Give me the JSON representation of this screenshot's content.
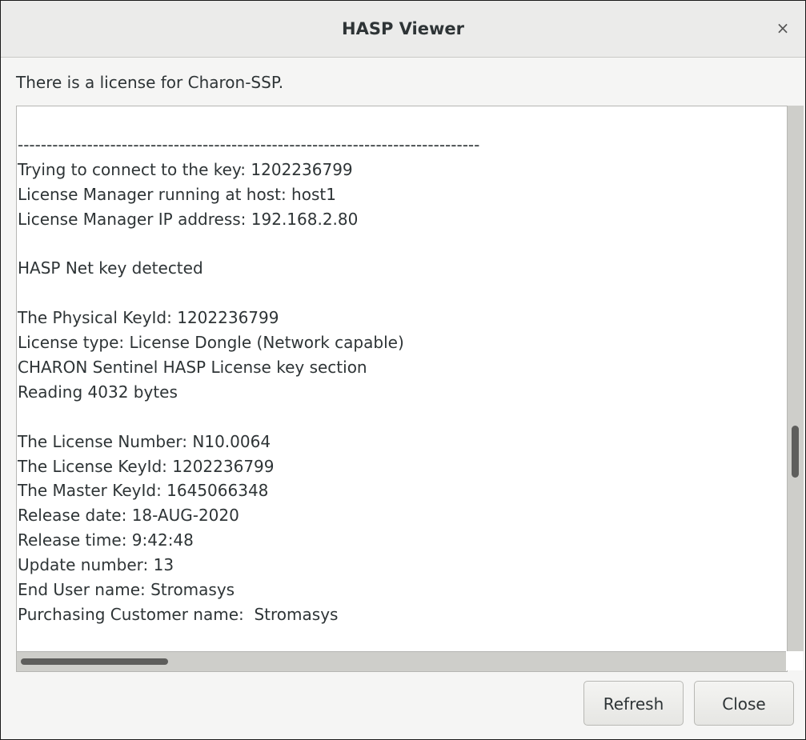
{
  "window": {
    "title": "HASP Viewer",
    "close_glyph": "×"
  },
  "status_text": "There is a license for Charon-SSP.",
  "log_lines": [
    "--------------------------------------------------------------------------------",
    "Trying to connect to the key: 1202236799",
    "License Manager running at host: host1",
    "License Manager IP address: 192.168.2.80",
    "",
    "HASP Net key detected",
    "",
    "The Physical KeyId: 1202236799",
    "License type: License Dongle (Network capable)",
    "CHARON Sentinel HASP License key section",
    "Reading 4032 bytes",
    "",
    "The License Number: N10.0064",
    "The License KeyId: 1202236799",
    "The Master KeyId: 1645066348",
    "Release date: 18-AUG-2020",
    "Release time: 9:42:48",
    "Update number: 13",
    "End User name: Stromasys",
    "Purchasing Customer name:  Stromasys"
  ],
  "buttons": {
    "refresh": "Refresh",
    "close": "Close"
  },
  "icons": {
    "title_close": "close-icon"
  }
}
